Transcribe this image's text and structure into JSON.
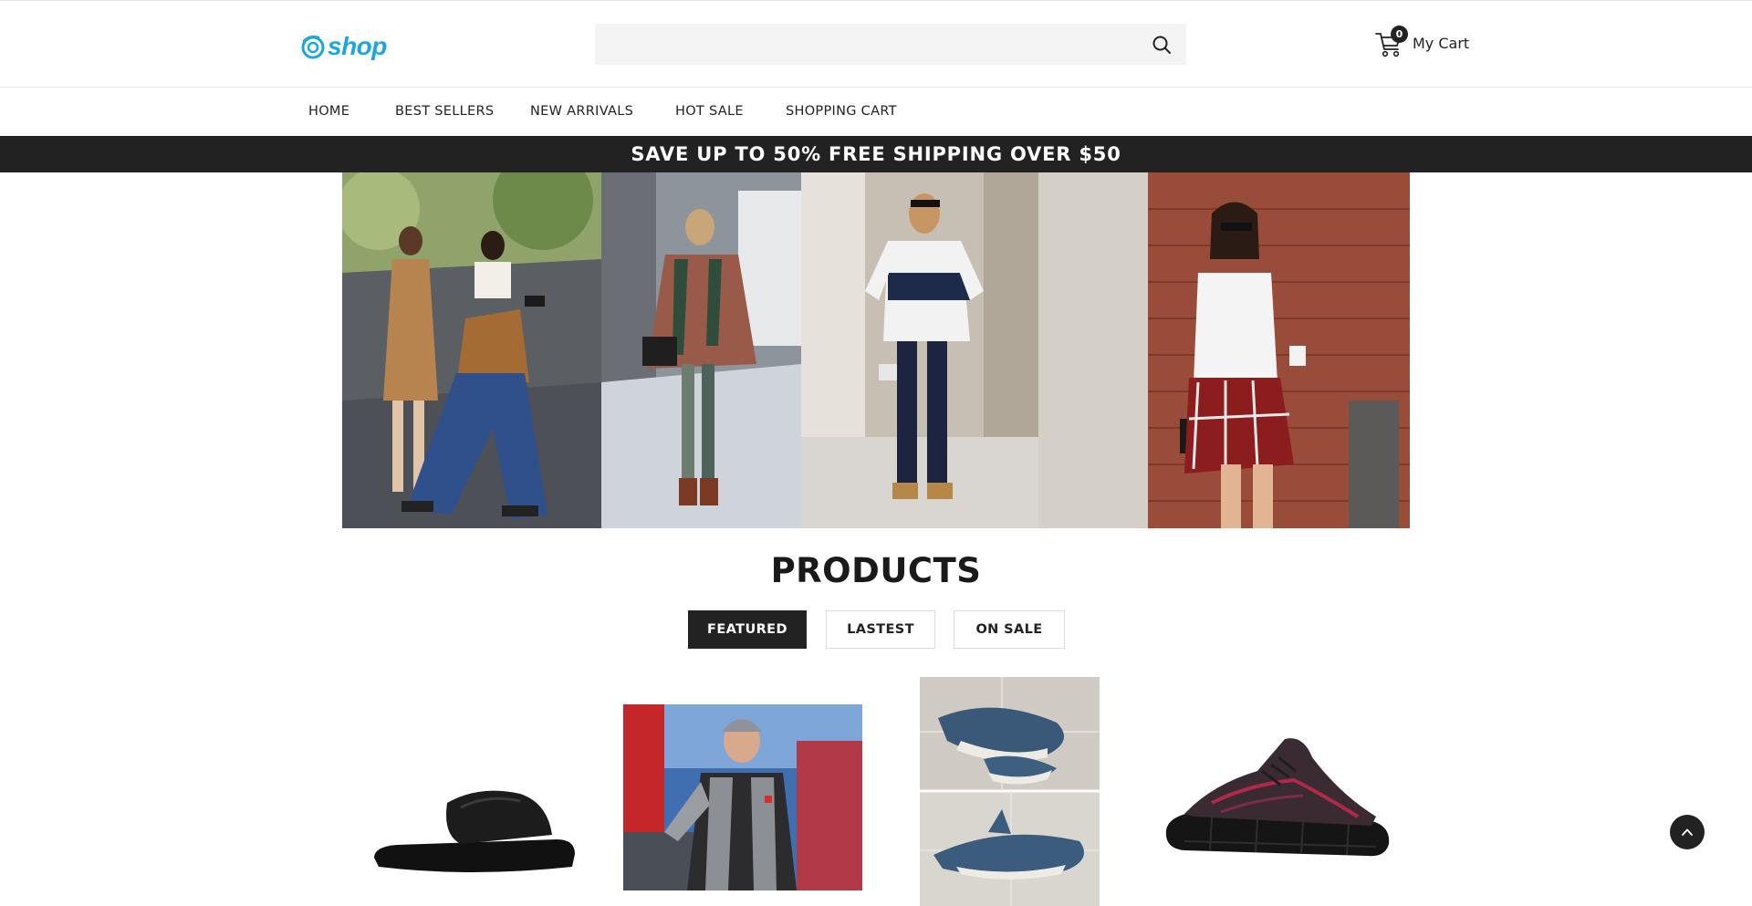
{
  "header": {
    "logo_text": "shop",
    "search": {
      "value": "",
      "placeholder": ""
    },
    "cart": {
      "count": "0",
      "label": "My Cart"
    }
  },
  "nav": {
    "items": [
      {
        "label": "HOME"
      },
      {
        "label": "BEST SELLERS"
      },
      {
        "label": "NEW ARRIVALS"
      },
      {
        "label": "HOT SALE"
      },
      {
        "label": "SHOPPING CART"
      }
    ]
  },
  "promo": {
    "text": "SAVE UP TO 50% FREE SHIPPING OVER $50"
  },
  "hero": {
    "panels": [
      "street-style-suede-jacket",
      "street-style-plaid-poncho",
      "street-style-striped-tee",
      "street-style-plaid-skirt"
    ]
  },
  "products_section": {
    "title": "PRODUCTS",
    "tabs": [
      {
        "label": "FEATURED",
        "active": true
      },
      {
        "label": "LASTEST",
        "active": false
      },
      {
        "label": "ON SALE",
        "active": false
      }
    ],
    "items": [
      "black-slide-sandal",
      "man-in-winter-vest",
      "blue-shark-plush",
      "knit-sneaker"
    ]
  },
  "colors": {
    "brand": "#1ba6dd",
    "dark": "#222222",
    "search_bg": "#f4f4f4"
  },
  "icons": {
    "search": "search-icon",
    "cart": "cart-icon",
    "back_to_top": "chevron-up-icon"
  }
}
